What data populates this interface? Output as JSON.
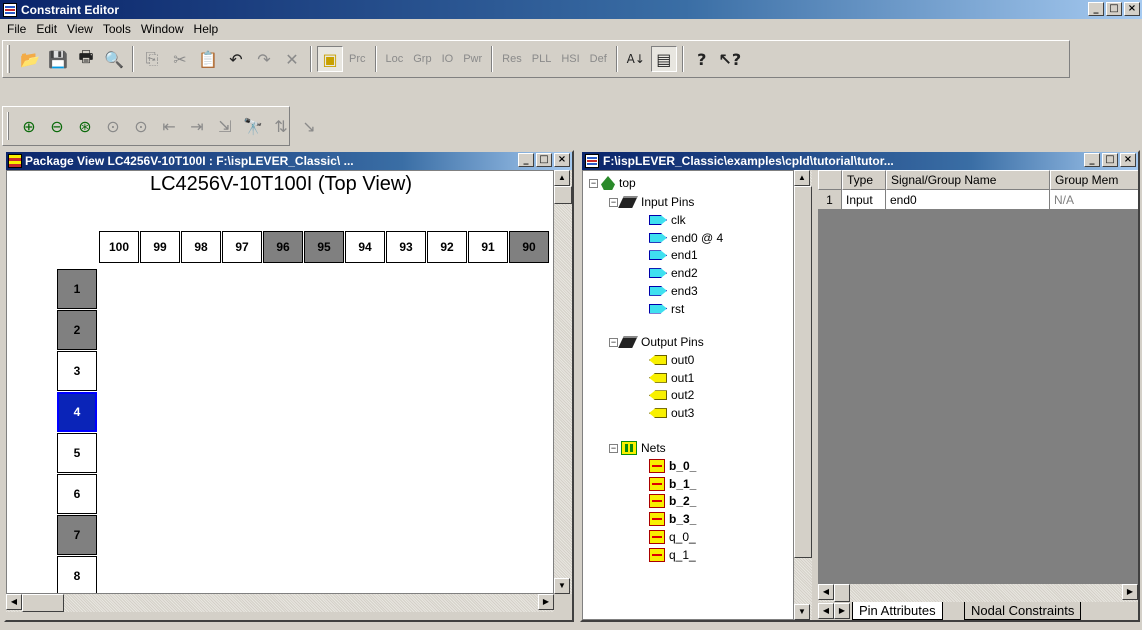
{
  "app": {
    "title": "Constraint Editor"
  },
  "menu": [
    "File",
    "Edit",
    "View",
    "Tools",
    "Window",
    "Help"
  ],
  "toolbar1": {
    "text_buttons": [
      "Prc",
      "Loc",
      "Grp",
      "IO",
      "Pwr",
      "Res",
      "PLL",
      "HSI",
      "Def"
    ]
  },
  "package_view": {
    "title": "Package View LC4256V-10T100I : F:\\ispLEVER_Classic\\ ...",
    "heading": "LC4256V-10T100I (Top View)",
    "top_pins": [
      {
        "n": "100",
        "color": "#ffffff"
      },
      {
        "n": "99",
        "color": "#ffffff"
      },
      {
        "n": "98",
        "color": "#ffffff"
      },
      {
        "n": "97",
        "color": "#ffffff"
      },
      {
        "n": "96",
        "color": "#808080"
      },
      {
        "n": "95",
        "color": "#808080"
      },
      {
        "n": "94",
        "color": "#ffffff"
      },
      {
        "n": "93",
        "color": "#ffffff"
      },
      {
        "n": "92",
        "color": "#ffffff"
      },
      {
        "n": "91",
        "color": "#ffffff"
      },
      {
        "n": "90",
        "color": "#808080"
      }
    ],
    "left_pins": [
      {
        "n": "1",
        "color": "#808080"
      },
      {
        "n": "2",
        "color": "#808080"
      },
      {
        "n": "3",
        "color": "#ffffff"
      },
      {
        "n": "4",
        "color": "#0a24b8",
        "text": "#ffffff"
      },
      {
        "n": "5",
        "color": "#ffffff"
      },
      {
        "n": "6",
        "color": "#ffffff"
      },
      {
        "n": "7",
        "color": "#808080"
      },
      {
        "n": "8",
        "color": "#ffffff"
      }
    ]
  },
  "spreadsheet": {
    "title": "F:\\ispLEVER_Classic\\examples\\cpld\\tutorial\\tutor...",
    "tree": {
      "root": "top",
      "input_group": "Input Pins",
      "inputs": [
        "clk",
        "end0 @ 4",
        "end1",
        "end2",
        "end3",
        "rst"
      ],
      "output_group": "Output Pins",
      "outputs": [
        "out0",
        "out1",
        "out2",
        "out3"
      ],
      "nets_group": "Nets",
      "nets": [
        {
          "label": "b_0_",
          "bold": true
        },
        {
          "label": "b_1_",
          "bold": true
        },
        {
          "label": "b_2_",
          "bold": true
        },
        {
          "label": "b_3_",
          "bold": true
        },
        {
          "label": "q_0_",
          "bold": false
        },
        {
          "label": "q_1_",
          "bold": false
        }
      ]
    },
    "grid": {
      "headers": [
        "",
        "Type",
        "Signal/Group Name",
        "Group Mem"
      ],
      "rows": [
        [
          "1",
          "Input",
          "end0",
          "N/A"
        ]
      ]
    },
    "tabs": [
      "Pin Attributes",
      "Nodal Constraints"
    ]
  }
}
